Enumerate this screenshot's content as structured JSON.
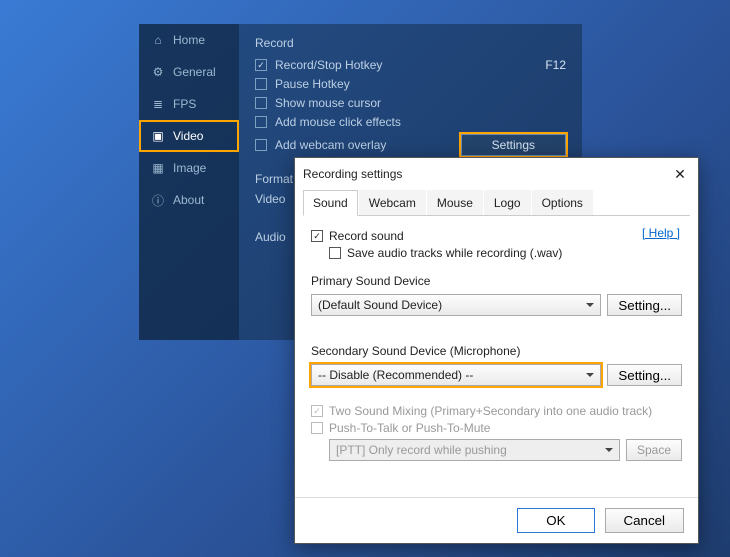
{
  "sidebar": {
    "items": [
      {
        "label": "Home"
      },
      {
        "label": "General"
      },
      {
        "label": "FPS"
      },
      {
        "label": "Video"
      },
      {
        "label": "Image"
      },
      {
        "label": "About"
      }
    ]
  },
  "record": {
    "section": "Record",
    "opts": {
      "record_stop": "Record/Stop Hotkey",
      "record_stop_val": "F12",
      "pause": "Pause Hotkey",
      "pause_val": "",
      "show_cursor": "Show mouse cursor",
      "click_fx": "Add mouse click effects",
      "webcam": "Add webcam overlay"
    },
    "settings_btn": "Settings",
    "format_section": "Format",
    "video_label": "Video",
    "audio_label": "Audio"
  },
  "dialog": {
    "title": "Recording settings",
    "tabs": [
      "Sound",
      "Webcam",
      "Mouse",
      "Logo",
      "Options"
    ],
    "record_sound": "Record sound",
    "save_tracks": "Save audio tracks while recording (.wav)",
    "help": "[ Help ]",
    "primary_label": "Primary Sound Device",
    "primary_value": "(Default Sound Device)",
    "setting_btn": "Setting...",
    "secondary_label": "Secondary Sound Device (Microphone)",
    "secondary_value": "-- Disable (Recommended) --",
    "two_mix": "Two Sound Mixing (Primary+Secondary into one audio track)",
    "ptt": "Push-To-Talk or Push-To-Mute",
    "ptt_mode": "[PTT] Only record while pushing",
    "ptt_key": "Space",
    "ok": "OK",
    "cancel": "Cancel"
  }
}
